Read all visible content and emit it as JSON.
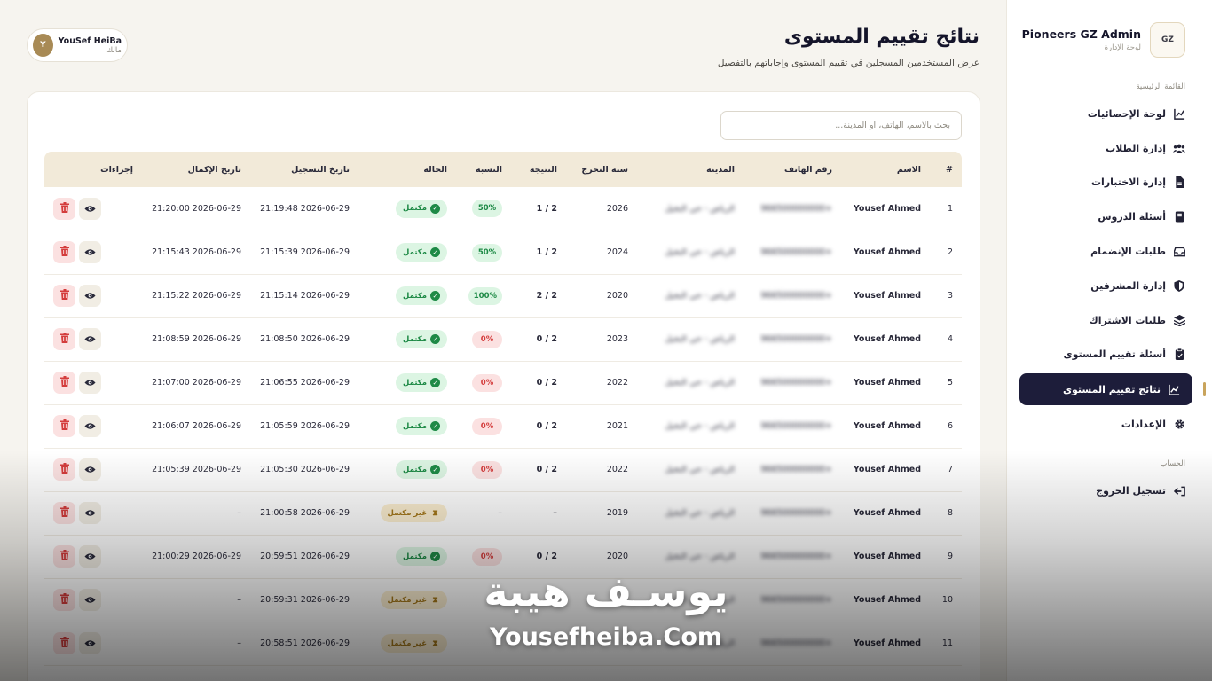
{
  "sidebar": {
    "brand_title": "Pioneers GZ Admin",
    "brand_sub": "لوحة الإدارة",
    "logo_text": "GZ",
    "section_main": "القائمة الرئيسية",
    "section_account": "الحساب",
    "items": [
      {
        "label": "لوحة الإحصائيات",
        "icon": "chart-line-icon"
      },
      {
        "label": "إدارة الطلاب",
        "icon": "users-icon"
      },
      {
        "label": "إدارة الاختبارات",
        "icon": "file-icon"
      },
      {
        "label": "أسئلة الدروس",
        "icon": "book-icon"
      },
      {
        "label": "طلبات الإنضمام",
        "icon": "inbox-icon"
      },
      {
        "label": "إدارة المشرفين",
        "icon": "shield-icon"
      },
      {
        "label": "طلبات الاشتراك",
        "icon": "layers-icon"
      },
      {
        "label": "أسئلة تقييم المستوى",
        "icon": "clipboard-icon"
      },
      {
        "label": "نتائج تقييم المستوى",
        "icon": "chart-line-icon",
        "active": true
      },
      {
        "label": "الإعدادات",
        "icon": "gear-icon"
      }
    ],
    "logout": "تسجيل الخروج"
  },
  "header": {
    "title": "نتائج تقييم المستوى",
    "subtitle": "عرض المستخدمين المسجلين في تقييم المستوى وإجاباتهم بالتفصيل"
  },
  "user": {
    "name": "YouSef HeiBa",
    "role": "مالك",
    "initial": "Y"
  },
  "search": {
    "placeholder": "بحث بالاسم، الهاتف، أو المدينة..."
  },
  "table": {
    "headers": {
      "index": "#",
      "name": "الاسم",
      "phone": "رقم الهاتف",
      "city": "المدينة",
      "grad_year": "سنة التخرج",
      "score": "النتيجة",
      "percent": "النسبة",
      "status": "الحالة",
      "registered": "تاريخ التسجيل",
      "completed": "تاريخ الإكمال",
      "actions": "إجراءات"
    },
    "status_done": "مكتمل",
    "status_pending": "غير مكتمل",
    "rows": [
      {
        "index": "1",
        "name": "Yousef Ahmed",
        "phone": "+966500000000",
        "city": "الرياض - حي النخيل",
        "grad_year": "2026",
        "score": "2 / 1",
        "percent": "50%",
        "pct_state": "good",
        "status": "مكتمل",
        "state": "done",
        "registered": "2026-06-29 21:19:48",
        "completed": "2026-06-29 21:20:00"
      },
      {
        "index": "2",
        "name": "Yousef Ahmed",
        "phone": "+966500000000",
        "city": "الرياض - حي النخيل",
        "grad_year": "2024",
        "score": "2 / 1",
        "percent": "50%",
        "pct_state": "good",
        "status": "مكتمل",
        "state": "done",
        "registered": "2026-06-29 21:15:39",
        "completed": "2026-06-29 21:15:43"
      },
      {
        "index": "3",
        "name": "Yousef Ahmed",
        "phone": "+966500000000",
        "city": "الرياض - حي النخيل",
        "grad_year": "2020",
        "score": "2 / 2",
        "percent": "100%",
        "pct_state": "good",
        "status": "مكتمل",
        "state": "done",
        "registered": "2026-06-29 21:15:14",
        "completed": "2026-06-29 21:15:22"
      },
      {
        "index": "4",
        "name": "Yousef Ahmed",
        "phone": "+966500000000",
        "city": "الرياض - حي النخيل",
        "grad_year": "2023",
        "score": "2 / 0",
        "percent": "0%",
        "pct_state": "bad",
        "status": "مكتمل",
        "state": "done",
        "registered": "2026-06-29 21:08:50",
        "completed": "2026-06-29 21:08:59"
      },
      {
        "index": "5",
        "name": "Yousef Ahmed",
        "phone": "+966500000000",
        "city": "الرياض - حي النخيل",
        "grad_year": "2022",
        "score": "2 / 0",
        "percent": "0%",
        "pct_state": "bad",
        "status": "مكتمل",
        "state": "done",
        "registered": "2026-06-29 21:06:55",
        "completed": "2026-06-29 21:07:00"
      },
      {
        "index": "6",
        "name": "Yousef Ahmed",
        "phone": "+966500000000",
        "city": "الرياض - حي النخيل",
        "grad_year": "2021",
        "score": "2 / 0",
        "percent": "0%",
        "pct_state": "bad",
        "status": "مكتمل",
        "state": "done",
        "registered": "2026-06-29 21:05:59",
        "completed": "2026-06-29 21:06:07"
      },
      {
        "index": "7",
        "name": "Yousef Ahmed",
        "phone": "+966500000000",
        "city": "الرياض - حي النخيل",
        "grad_year": "2022",
        "score": "2 / 0",
        "percent": "0%",
        "pct_state": "bad",
        "status": "مكتمل",
        "state": "done",
        "registered": "2026-06-29 21:05:30",
        "completed": "2026-06-29 21:05:39"
      },
      {
        "index": "8",
        "name": "Yousef Ahmed",
        "phone": "+966500000000",
        "city": "الرياض - حي النخيل",
        "grad_year": "2019",
        "score": "–",
        "percent": "–",
        "pct_state": "none",
        "status": "غير مكتمل",
        "state": "pending",
        "registered": "2026-06-29 21:00:58",
        "completed": "–"
      },
      {
        "index": "9",
        "name": "Yousef Ahmed",
        "phone": "+966500000000",
        "city": "الرياض - حي النخيل",
        "grad_year": "2020",
        "score": "2 / 0",
        "percent": "0%",
        "pct_state": "bad",
        "status": "مكتمل",
        "state": "done",
        "registered": "2026-06-29 20:59:51",
        "completed": "2026-06-29 21:00:29"
      },
      {
        "index": "10",
        "name": "Yousef Ahmed",
        "phone": "+966500000000",
        "city": "الرياض - حي النخيل",
        "grad_year": "",
        "score": "",
        "percent": "",
        "pct_state": "none",
        "status": "غير مكتمل",
        "state": "pending",
        "registered": "2026-06-29 20:59:31",
        "completed": "–"
      },
      {
        "index": "11",
        "name": "Yousef Ahmed",
        "phone": "+966500000000",
        "city": "الرياض - حي النخيل",
        "grad_year": "",
        "score": "",
        "percent": "",
        "pct_state": "none",
        "status": "غير مكتمل",
        "state": "pending",
        "registered": "2026-06-29 20:58:51",
        "completed": "–"
      }
    ]
  },
  "watermark": {
    "arabic": "يوسـف هيبة",
    "latin": "Yousefheiba.Com"
  },
  "colors": {
    "accent": "#1d1d3a",
    "gold": "#c9a45c",
    "success": "#1e8a46",
    "danger": "#d43c3c",
    "warning": "#a5781a"
  }
}
